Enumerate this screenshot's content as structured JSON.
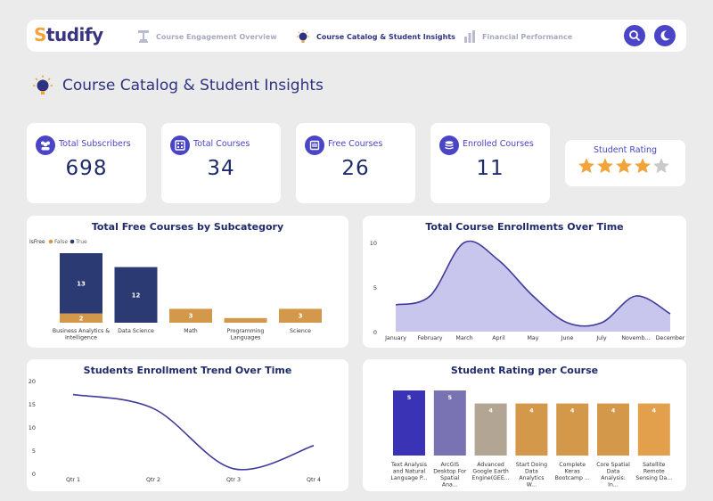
{
  "app": {
    "logo_first_letter": "S",
    "logo_rest": "tudify"
  },
  "nav": {
    "items": [
      {
        "label": "Course Engagement Overview",
        "icon": "trophy-icon",
        "active": false
      },
      {
        "label": "Course Catalog & Student Insights",
        "icon": "lightbulb-icon",
        "active": true
      },
      {
        "label": "Financial Performance",
        "icon": "finance-icon",
        "active": false
      }
    ],
    "search_icon": "search-icon",
    "theme_icon": "moon-icon"
  },
  "page": {
    "title": "Course Catalog & Student Insights"
  },
  "kpis": [
    {
      "label": "Total Subscribers",
      "value": "698",
      "icon": "users-icon"
    },
    {
      "label": "Total Courses",
      "value": "34",
      "icon": "courses-icon"
    },
    {
      "label": "Free Courses",
      "value": "26",
      "icon": "free-icon"
    },
    {
      "label": "Enrolled Courses",
      "value": "11",
      "icon": "stack-icon"
    }
  ],
  "rating": {
    "label": "Student Rating",
    "value": 4,
    "max": 5
  },
  "colors": {
    "accent": "#4a44c6",
    "navy": "#2b3a73",
    "gold": "#d4984a",
    "area": "#c8c6ec",
    "line": "#3f3b9a",
    "star_on": "#f2a33a",
    "star_off": "#c9c9c9"
  },
  "free_courses_chart": {
    "title": "Total Free Courses by Subcategory",
    "legend_title": "IsFree",
    "legend": [
      {
        "label": "False",
        "color": "#d4984a"
      },
      {
        "label": "True",
        "color": "#2b3a73"
      }
    ]
  },
  "enrollments_time_chart": {
    "title": "Total Course Enrollments Over Time"
  },
  "enroll_trend_chart": {
    "title": "Students Enrollment Trend Over Time"
  },
  "rating_course_chart": {
    "title": "Student Rating per Course"
  },
  "chart_data": [
    {
      "type": "bar",
      "title": "Total Free Courses by Subcategory",
      "categories": [
        "Business Analytics & Intelligence",
        "Data Science",
        "Math",
        "Programming Languages",
        "Science"
      ],
      "series": [
        {
          "name": "False",
          "values": [
            2,
            0,
            3,
            1,
            3
          ]
        },
        {
          "name": "True",
          "values": [
            13,
            12,
            0,
            0,
            0
          ]
        }
      ],
      "stacked": true,
      "ylim": [
        0,
        15
      ]
    },
    {
      "type": "area",
      "title": "Total Course Enrollments Over Time",
      "categories": [
        "January",
        "February",
        "March",
        "April",
        "May",
        "June",
        "July",
        "Novemb...",
        "December"
      ],
      "values": [
        3,
        4,
        10,
        8,
        4,
        1,
        1,
        4,
        2
      ],
      "yticks": [
        0,
        5,
        10
      ],
      "ylim": [
        0,
        10.5
      ]
    },
    {
      "type": "line",
      "title": "Students Enrollment Trend Over Time",
      "categories": [
        "Qtr 1",
        "Qtr 2",
        "Qtr 3",
        "Qtr 4"
      ],
      "values": [
        17,
        14,
        1,
        6
      ],
      "yticks": [
        0,
        5,
        10,
        15,
        20
      ],
      "ylim": [
        0,
        20
      ]
    },
    {
      "type": "bar",
      "title": "Student Rating per Course",
      "categories": [
        "Text Analysis and Natural Language P...",
        "ArcGIS Desktop For Spatial Ana...",
        "Advanced Google Earth Engine(GEE...",
        "Start Doing Data Analytics W...",
        "Complete Keras Bootcamp ...",
        "Core Spatial Data Analysis: In...",
        "Satellite Remote Sensing Da..."
      ],
      "values": [
        5,
        5,
        4,
        4,
        4,
        4,
        4
      ],
      "data_labels": [
        "5",
        "5",
        "4",
        "4",
        "4",
        "4",
        "4"
      ],
      "ylim": [
        0,
        5
      ]
    }
  ]
}
